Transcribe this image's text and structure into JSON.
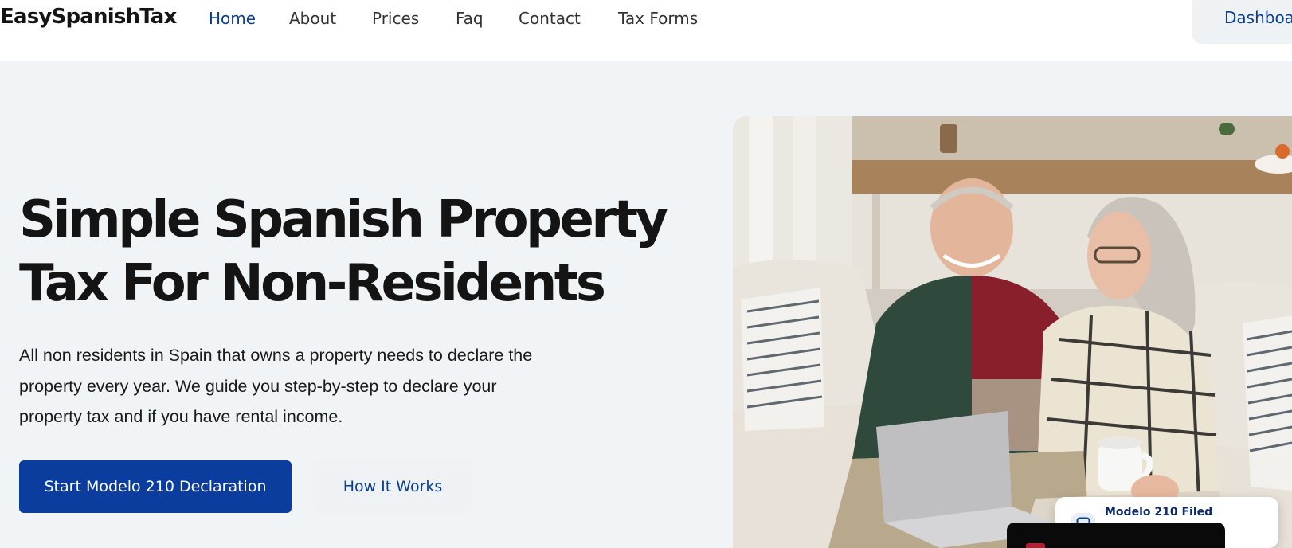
{
  "header": {
    "logo": "EasySpanishTax",
    "nav": [
      "Home",
      "About",
      "Prices",
      "Faq",
      "Contact",
      "Tax Forms"
    ],
    "active_nav": "Home",
    "dashboard_label": "Dashboa"
  },
  "hero": {
    "title_lines": [
      "Simple Spanish Property",
      "Tax For Non-Residents"
    ],
    "description_lines": [
      "All non residents in Spain that owns a property needs to declare the",
      "property every year. We guide you step-by-step to declare your",
      "property tax and if you have rental income."
    ],
    "primary_button": "Start Modelo 210 Declaration",
    "secondary_button": "How It Works"
  },
  "image": {
    "subject": "older couple on a sofa looking at a laptop",
    "overlay_card": {
      "label": "Modelo 210 Filed",
      "icon": "document-icon"
    },
    "flag_icon": "us-flag-icon"
  },
  "colors": {
    "brand_blue": "#0b3d9f",
    "nav_active": "#0b3d91",
    "page_background": "#f0f4f6",
    "header_background": "#ffffff",
    "text_dark": "#141414"
  }
}
